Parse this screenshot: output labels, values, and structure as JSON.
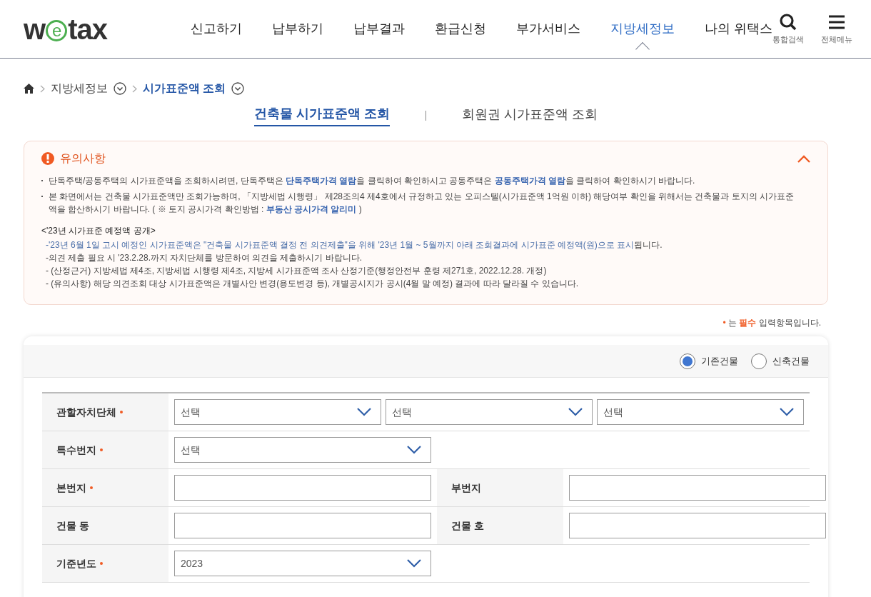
{
  "header": {
    "logo": {
      "before": "w",
      "mark": "e",
      "after": "tax"
    },
    "nav": [
      {
        "label": "신고하기",
        "selected": false
      },
      {
        "label": "납부하기",
        "selected": false
      },
      {
        "label": "납부결과",
        "selected": false
      },
      {
        "label": "환급신청",
        "selected": false
      },
      {
        "label": "부가서비스",
        "selected": false
      },
      {
        "label": "지방세정보",
        "selected": true
      },
      {
        "label": "나의 위택스",
        "selected": false
      }
    ],
    "tools": [
      {
        "kind": "search",
        "label": "통합검색"
      },
      {
        "kind": "menu",
        "label": "전체메뉴"
      }
    ]
  },
  "breadcrumb": [
    {
      "label": "지방세정보",
      "current": false
    },
    {
      "label": "시가표준액 조회",
      "current": true
    }
  ],
  "tabs": [
    {
      "label": "건축물 시가표준액 조회",
      "selected": true
    },
    {
      "label": "회원권 시가표준액 조회",
      "selected": false
    }
  ],
  "notice": {
    "title": "유의사항",
    "expanded": true,
    "bullets": [
      [
        {
          "kind": "plain",
          "text": "단독주택/공동주택의 시가표준액을 조회하시려면, 단독주택은 "
        },
        {
          "kind": "link",
          "text": "단독주택가격 열람"
        },
        {
          "kind": "plain",
          "text": "을 클릭하여 확인하시고 공동주택은 "
        },
        {
          "kind": "link",
          "text": "공동주택가격 열람"
        },
        {
          "kind": "plain",
          "text": "을 클릭하여 확인하시기 바랍니다."
        }
      ],
      [
        {
          "kind": "plain",
          "text": "본 화면에서는 건축물 시가표준액만 조회가능하며, 「지방세법 시행령」 제28조의4 제4호에서 규정하고 있는 오피스텔(시가표준액 1억원 이하) 해당여부 확인을 위해서는 건축물과 토지의 시가표준액을 합산하시기 바랍니다. ( ※ 토지 공시가격 확인방법 : "
        },
        {
          "kind": "link",
          "text": "부동산 공시가격 알리미"
        },
        {
          "kind": "plain",
          "text": " )"
        }
      ]
    ],
    "section_title": "<'23년 시가표준 예정액 공개>",
    "lines": [
      [
        {
          "kind": "accent",
          "text": "-'23년 6월 1일 고시 예정인 시가표준액은 \"건축물 시가표준액 결정 전 의견제출\"을 위해 '23년 1월 ~ 5월까지 아래 조회결과에 시가표준 예정액(원)으로 표시"
        },
        {
          "kind": "plain",
          "text": "됩니다."
        }
      ],
      [
        {
          "kind": "plain",
          "text": "-의견 제출 필요 시 '23.2.28.까지 자치단체를 방문하여 의견을 제출하시기 바랍니다."
        }
      ],
      [
        {
          "kind": "plain",
          "text": "- (산정근거) 지방세법 제4조, 지방세법 시행령 제4조, 지방세 시가표준액 조사 산정기준(행정안전부 훈령 제271호, 2022.12.28. 개정)"
        }
      ],
      [
        {
          "kind": "plain",
          "text": "- (유의사항) 해당 의견조회 대상 시가표준액은 개별사안 변경(용도변경 등), 개별공시지가 공시(4월 말 예정) 결과에 따라 달라질 수 있습니다."
        }
      ]
    ]
  },
  "required_note": {
    "mark": "•",
    "before": "는 ",
    "strong": "필수",
    "after": " 입력항목입니다."
  },
  "building_type": [
    {
      "label": "기존건물",
      "selected": true
    },
    {
      "label": "신축건물",
      "selected": false
    }
  ],
  "form": [
    {
      "cells": [
        {
          "label": "관할자치단체",
          "required": true,
          "fields": [
            {
              "kind": "select",
              "value": "선택"
            },
            {
              "kind": "select",
              "value": "선택"
            },
            {
              "kind": "select",
              "value": "선택"
            }
          ]
        }
      ]
    },
    {
      "cells": [
        {
          "label": "특수번지",
          "required": true,
          "fields": [
            {
              "kind": "select",
              "value": "선택"
            }
          ]
        }
      ]
    },
    {
      "cells": [
        {
          "label": "본번지",
          "required": true,
          "fields": [
            {
              "kind": "text"
            }
          ]
        },
        {
          "label": "부번지",
          "required": false,
          "fields": [
            {
              "kind": "text"
            }
          ]
        }
      ]
    },
    {
      "cells": [
        {
          "label": "건물 동",
          "required": false,
          "fields": [
            {
              "kind": "text"
            }
          ]
        },
        {
          "label": "건물 호",
          "required": false,
          "fields": [
            {
              "kind": "text"
            }
          ]
        }
      ]
    },
    {
      "cells": [
        {
          "label": "기준년도",
          "required": true,
          "fields": [
            {
              "kind": "select",
              "value": "2023"
            }
          ]
        }
      ]
    }
  ]
}
